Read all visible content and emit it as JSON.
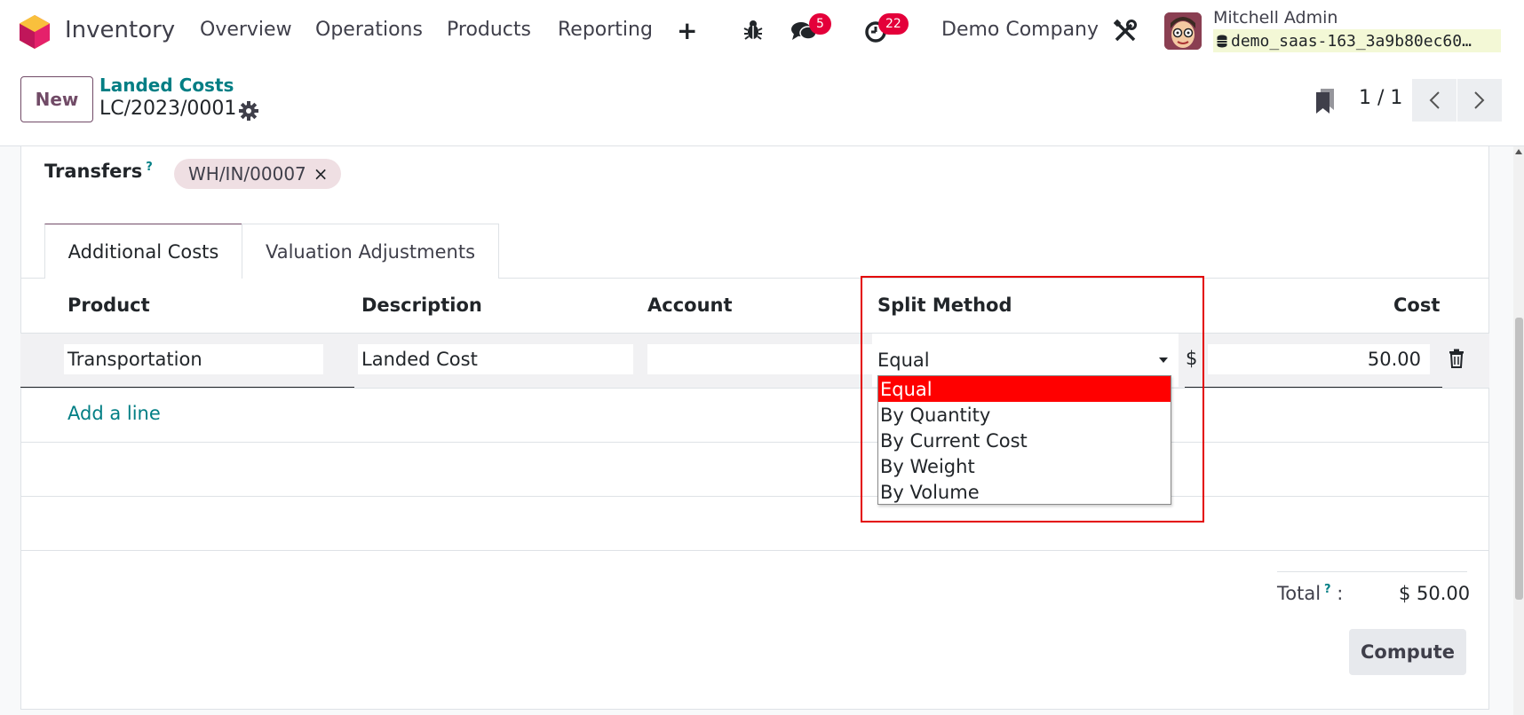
{
  "nav": {
    "app_name": "Inventory",
    "items": [
      "Overview",
      "Operations",
      "Products",
      "Reporting"
    ],
    "messages_badge": "5",
    "activities_badge": "22",
    "company": "Demo Company",
    "user_name": "Mitchell Admin",
    "database": "demo_saas-163_3a9b80ec60…"
  },
  "control": {
    "new_label": "New",
    "breadcrumb_parent": "Landed Costs",
    "breadcrumb_current": "LC/2023/0001",
    "pager": "1 / 1"
  },
  "form": {
    "transfers_label": "Transfers",
    "help_mark": "?",
    "transfer_tag": "WH/IN/00007",
    "tag_remove": "×",
    "tabs": [
      "Additional Costs",
      "Valuation Adjustments"
    ],
    "columns": [
      "Product",
      "Description",
      "Account",
      "Split Method",
      "Cost"
    ],
    "row": {
      "product": "Transportation",
      "description": "Landed Cost",
      "account": "",
      "split_method": "Equal",
      "currency": "$",
      "cost": "50.00"
    },
    "add_line": "Add a line",
    "split_options": [
      "Equal",
      "By Quantity",
      "By Current Cost",
      "By Weight",
      "By Volume"
    ],
    "total_label": "Total",
    "total_colon": ":",
    "total_value": "$ 50.00",
    "compute_label": "Compute"
  },
  "colors": {
    "brand": "#714b67",
    "link": "#017e84",
    "badge": "#e4003a",
    "highlight": "#e30000"
  }
}
